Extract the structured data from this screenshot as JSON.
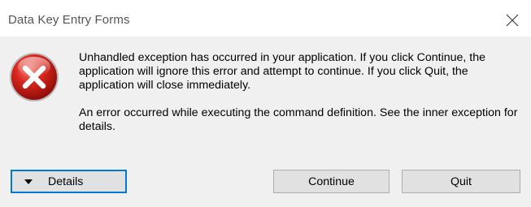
{
  "window": {
    "title": "Data Key Entry Forms",
    "close_icon": "close-icon"
  },
  "icon": {
    "name": "error-icon",
    "color": "#d9261c"
  },
  "message": {
    "primary": "Unhandled exception has occurred in your application. If you click Continue, the application will ignore this error and attempt to continue. If you click Quit, the application will close immediately.",
    "detail": "An error occurred while executing the command definition. See the inner exception for details."
  },
  "buttons": {
    "details_label": "Details",
    "continue_label": "Continue",
    "quit_label": "Quit"
  },
  "colors": {
    "focus_border": "#0078d7",
    "button_face": "#e1e1e1",
    "dialog_bg": "#f0f0f0"
  }
}
